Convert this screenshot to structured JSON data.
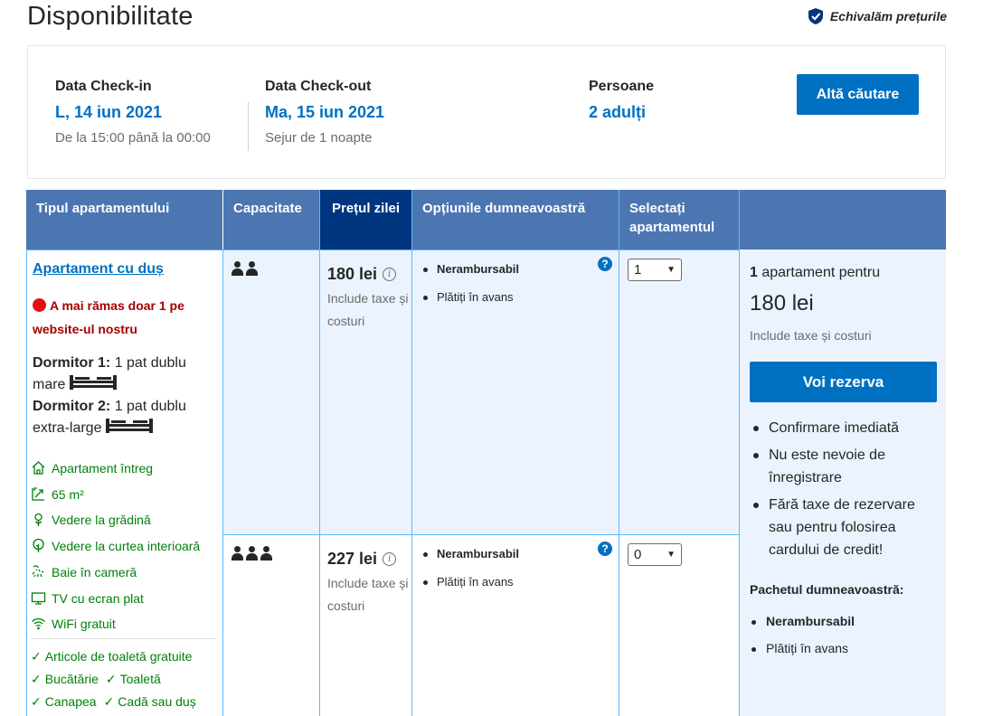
{
  "page": {
    "title": "Disponibilitate",
    "price_match": "Echivalăm prețurile"
  },
  "search": {
    "checkin_label": "Data Check-in",
    "checkin_value": "L, 14 iun 2021",
    "checkin_sub": "De la 15:00 până la 00:00",
    "checkout_label": "Data Check-out",
    "checkout_value": "Ma, 15 iun 2021",
    "checkout_sub": "Sejur de 1 noapte",
    "guests_label": "Persoane",
    "guests_value": "2 adulți",
    "button": "Altă căutare"
  },
  "table": {
    "headers": {
      "type": "Tipul apartamentului",
      "capacity": "Capacitate",
      "price": "Prețul zilei",
      "options": "Opțiunile dumneavoastră",
      "select": "Selectați apartamentul"
    }
  },
  "room": {
    "name": "Apartament cu duș",
    "scarcity": "A mai rămas doar 1 pe website-ul nostru",
    "bed1_label": "Dormitor 1:",
    "bed1_text": "1 pat dublu mare",
    "bed2_label": "Dormitor 2:",
    "bed2_text": "1 pat dublu extra-large",
    "facilities": [
      {
        "icon": "home-icon",
        "label": "Apartament întreg"
      },
      {
        "icon": "size-icon",
        "label": "65 m²"
      },
      {
        "icon": "flower-icon",
        "label": "Vedere la grădină"
      },
      {
        "icon": "tree-icon",
        "label": "Vedere la curtea interioară"
      },
      {
        "icon": "bath-icon",
        "label": "Baie în cameră"
      },
      {
        "icon": "tv-icon",
        "label": "TV cu ecran plat"
      },
      {
        "icon": "wifi-icon",
        "label": "WiFi gratuit"
      }
    ],
    "amenities": [
      "Articole de toaletă gratuite",
      "Bucătărie",
      "Toaletă",
      "Canapea",
      "Cadă sau duș"
    ]
  },
  "rates": [
    {
      "guests": 2,
      "price": "180 lei",
      "price_sub": "Include taxe și costuri",
      "option_bold": "Nerambursabil",
      "option_plain": "Plătiți în avans",
      "qty": "1"
    },
    {
      "guests": 3,
      "price": "227 lei",
      "price_sub": "Include taxe și costuri",
      "option_bold": "Nerambursabil",
      "option_plain": "Plătiți în avans",
      "qty": "0"
    }
  ],
  "summary": {
    "count_num": "1",
    "count_text": " apartament pentru",
    "price": "180 lei",
    "tax": "Include taxe și costuri",
    "reserve_button": "Voi rezerva",
    "benefits": [
      "Confirmare imediată",
      "Nu este nevoie de înregistrare",
      "Fără taxe de rezervare sau pentru folosirea cardului de credit!"
    ],
    "package_title": "Pachetul dumneavoastră:",
    "package_items": [
      "Nerambursabil",
      "Plătiți în avans"
    ]
  },
  "colors": {
    "brand_blue": "#0071c2",
    "header_blue": "#4c76b2",
    "header_dark": "#003580",
    "row_bg": "#ebf3ff",
    "green": "#008009",
    "urgent_red": "#a30000"
  }
}
